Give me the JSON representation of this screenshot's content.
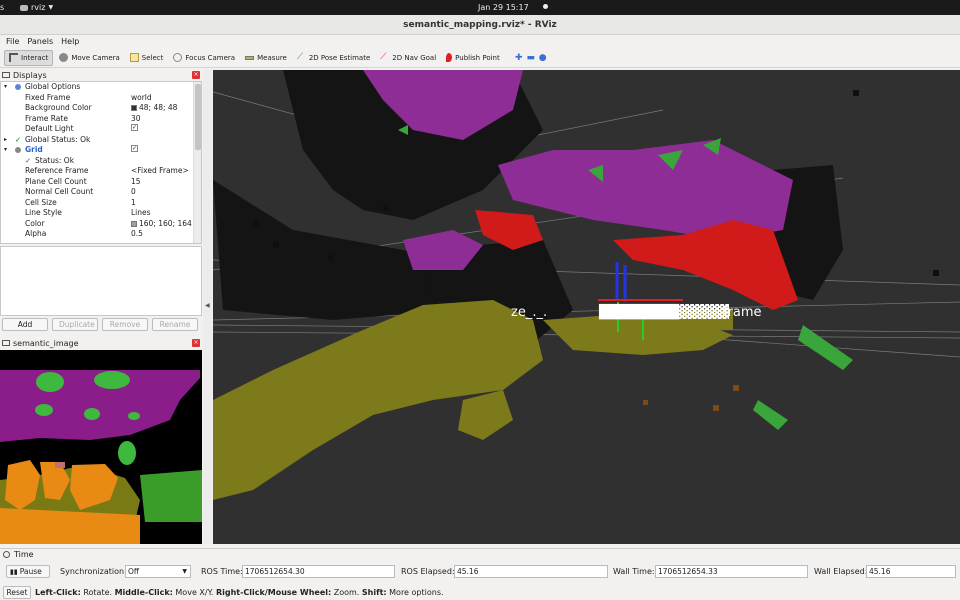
{
  "system": {
    "activities": "s",
    "app_name": "rviz",
    "clock": "Jan 29  15:17"
  },
  "window": {
    "title": "semantic_mapping.rviz* - RViz"
  },
  "menu": [
    "File",
    "Panels",
    "Help"
  ],
  "toolbar": {
    "interact": "Interact",
    "move_camera": "Move Camera",
    "select": "Select",
    "focus_camera": "Focus Camera",
    "measure": "Measure",
    "pose_estimate": "2D Pose Estimate",
    "nav_goal": "2D Nav Goal",
    "publish_point": "Publish Point"
  },
  "displays": {
    "title": "Displays",
    "rows": [
      {
        "label": "Global Options",
        "value": "",
        "indent": 1
      },
      {
        "label": "Fixed Frame",
        "value": "world",
        "indent": 2
      },
      {
        "label": "Background Color",
        "value": "48; 48; 48",
        "indent": 2,
        "swatch": "#303030"
      },
      {
        "label": "Frame Rate",
        "value": "30",
        "indent": 2
      },
      {
        "label": "Default Light",
        "value": "✓",
        "indent": 2,
        "check": true
      },
      {
        "label": "Global Status: Ok",
        "value": "",
        "indent": 1
      },
      {
        "label": "Grid",
        "value": "✓",
        "indent": 1,
        "check": true
      },
      {
        "label": "Status: Ok",
        "value": "",
        "indent": 2
      },
      {
        "label": "Reference Frame",
        "value": "<Fixed Frame>",
        "indent": 2
      },
      {
        "label": "Plane Cell Count",
        "value": "15",
        "indent": 2
      },
      {
        "label": "Normal Cell Count",
        "value": "0",
        "indent": 2
      },
      {
        "label": "Cell Size",
        "value": "1",
        "indent": 2
      },
      {
        "label": "Line Style",
        "value": "Lines",
        "indent": 2
      },
      {
        "label": "Color",
        "value": "160; 160; 164",
        "indent": 2,
        "swatch": "#a0a0a4"
      },
      {
        "label": "Alpha",
        "value": "0.5",
        "indent": 2
      }
    ],
    "buttons": {
      "add": "Add",
      "duplicate": "Duplicate",
      "remove": "Remove",
      "rename": "Rename"
    }
  },
  "image_panel": {
    "title": "semantic_image"
  },
  "view3d": {
    "label_left": "ze_._.",
    "label_right": "frame"
  },
  "time": {
    "title": "Time",
    "pause": "Pause",
    "sync_label": "Synchronization:",
    "sync_value": "Off",
    "ros_time_label": "ROS Time:",
    "ros_time": "1706512654.30",
    "ros_elapsed_label": "ROS Elapsed:",
    "ros_elapsed": "45.16",
    "wall_time_label": "Wall Time:",
    "wall_time": "1706512654.33",
    "wall_elapsed_label": "Wall Elapsed:",
    "wall_elapsed": "45.16"
  },
  "status": {
    "reset": "Reset",
    "left_click": "Left-Click:",
    "left_desc": "Rotate.",
    "middle_click": "Middle-Click:",
    "middle_desc": "Move X/Y.",
    "right_click": "Right-Click/Mouse Wheel:",
    "right_desc": "Zoom.",
    "shift": "Shift:",
    "shift_desc": "More options."
  }
}
